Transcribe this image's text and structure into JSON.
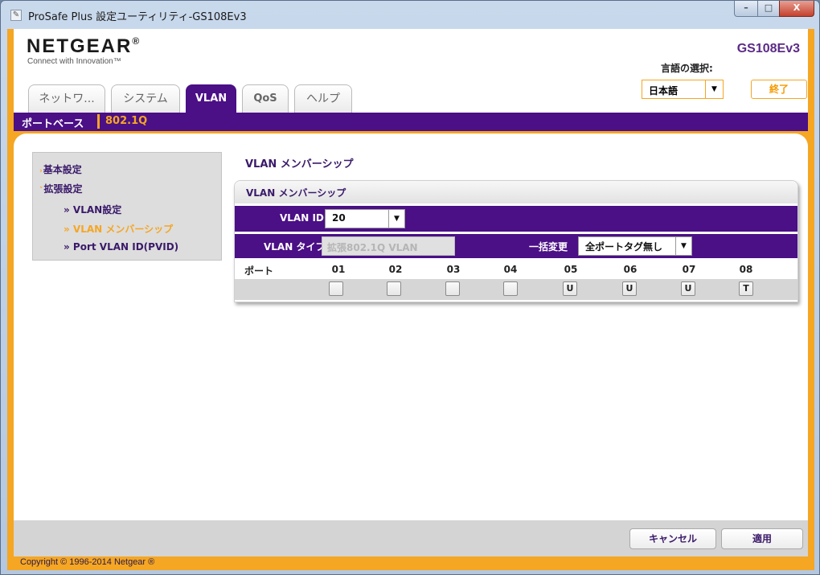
{
  "window": {
    "title": "ProSafe Plus 設定ユーティリティ-GS108Ev3",
    "min": "–",
    "max": "□",
    "close": "X"
  },
  "header": {
    "logo": "NETGEAR",
    "logo_mark": "®",
    "tagline": "Connect with Innovation™",
    "model": "GS108Ev3",
    "lang_label": "言語の選択:",
    "lang_value": "日本語",
    "exit_label": "終了"
  },
  "tabs": [
    {
      "label": "ネットワ...",
      "active": false
    },
    {
      "label": "システム",
      "active": false
    },
    {
      "label": "VLAN",
      "active": true
    },
    {
      "label": "QoS",
      "active": false
    },
    {
      "label": "ヘルプ",
      "active": false
    }
  ],
  "subnav": {
    "port_based": "ポートベース",
    "dot1q": "802.1Q"
  },
  "sidebar": {
    "basic": "基本設定",
    "advanced": "拡張設定",
    "items": [
      {
        "label": "» VLAN設定",
        "active": false
      },
      {
        "label": "» VLAN メンバーシップ",
        "active": true
      },
      {
        "label": "» Port VLAN ID(PVID)",
        "active": false
      }
    ]
  },
  "main": {
    "section_title": "VLAN メンバーシップ",
    "panel_title": "VLAN メンバーシップ",
    "vlan_id_label": "VLAN ID",
    "vlan_id_value": "20",
    "vlan_type_label": "VLAN タイプ",
    "vlan_type_value": "拡張802.1Q VLAN",
    "bulk_label": "一括変更",
    "bulk_value": "全ポートタグ無し",
    "port_label": "ポート",
    "ports": [
      {
        "num": "01",
        "state": ""
      },
      {
        "num": "02",
        "state": ""
      },
      {
        "num": "03",
        "state": ""
      },
      {
        "num": "04",
        "state": ""
      },
      {
        "num": "05",
        "state": "U"
      },
      {
        "num": "06",
        "state": "U"
      },
      {
        "num": "07",
        "state": "U"
      },
      {
        "num": "08",
        "state": "T"
      }
    ]
  },
  "footer": {
    "cancel": "キャンセル",
    "apply": "適用",
    "copyright": "Copyright © 1996-2014 Netgear ®"
  },
  "colors": {
    "accent_orange": "#f5a623",
    "brand_purple": "#4b0f86"
  }
}
